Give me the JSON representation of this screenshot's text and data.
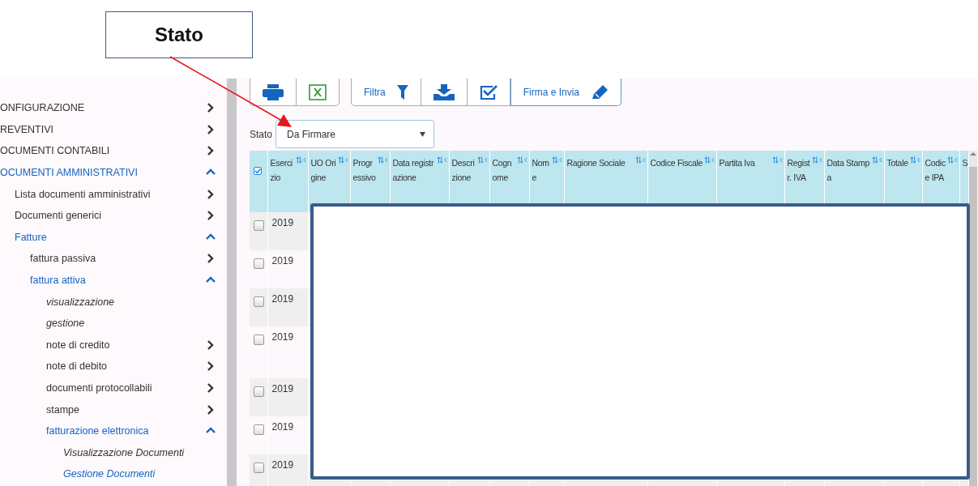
{
  "callout": {
    "label": "Stato"
  },
  "sidebar": {
    "items": [
      {
        "label": "ONFIGURAZIONE",
        "kind": "folder",
        "expanded": false,
        "active": false
      },
      {
        "label": "REVENTIVI",
        "kind": "folder",
        "expanded": false,
        "active": false
      },
      {
        "label": "OCUMENTI CONTABILI",
        "kind": "folder",
        "expanded": false,
        "active": false
      },
      {
        "label": "OCUMENTI AMMINISTRATIVI",
        "kind": "folder",
        "expanded": true,
        "active": true,
        "children": [
          {
            "label": "Lista documenti amministrativi",
            "kind": "folder",
            "expanded": false,
            "active": false
          },
          {
            "label": "Documenti generici",
            "kind": "folder",
            "expanded": false,
            "active": false
          },
          {
            "label": "Fatture",
            "kind": "folder",
            "expanded": true,
            "active": true,
            "children": [
              {
                "label": "fattura passiva",
                "kind": "folder",
                "expanded": false,
                "active": false
              },
              {
                "label": "fattura attiva",
                "kind": "folder",
                "expanded": true,
                "active": true,
                "children": [
                  {
                    "label": "visualizzazione",
                    "kind": "page",
                    "active": false
                  },
                  {
                    "label": "gestione",
                    "kind": "page",
                    "active": false
                  },
                  {
                    "label": "note di credito",
                    "kind": "folder",
                    "expanded": false,
                    "active": false
                  },
                  {
                    "label": "note di debito",
                    "kind": "folder",
                    "expanded": false,
                    "active": false
                  },
                  {
                    "label": "documenti protocollabili",
                    "kind": "folder",
                    "expanded": false,
                    "active": false
                  },
                  {
                    "label": "stampe",
                    "kind": "folder",
                    "expanded": false,
                    "active": false
                  },
                  {
                    "label": "fatturazione elettronica",
                    "kind": "folder",
                    "expanded": true,
                    "active": true,
                    "children": [
                      {
                        "label": "Visualizzazione Documenti",
                        "kind": "page",
                        "active": false
                      },
                      {
                        "label": "Gestione Documenti",
                        "kind": "page",
                        "active": true
                      }
                    ]
                  }
                ]
              }
            ]
          }
        ]
      }
    ]
  },
  "toolbar": [
    {
      "buttons": [
        {
          "kind": "print"
        },
        {
          "kind": "excel"
        }
      ]
    },
    {
      "buttons": [
        {
          "kind": "filter",
          "label": "Filtra",
          "highlighted": false
        },
        {
          "kind": "download",
          "highlighted": false
        },
        {
          "kind": "check",
          "highlighted": false
        },
        {
          "kind": "pencil",
          "label": "Firma e Invia",
          "highlighted": true
        }
      ]
    }
  ],
  "filter": {
    "label": "Stato",
    "value": "Da Firmare"
  },
  "table": {
    "select_all": {
      "checked": true
    },
    "columns": [
      {
        "label": "Esercizio",
        "sortable": true
      },
      {
        "label": "UO Origine",
        "sortable": true
      },
      {
        "label": "Progressivo",
        "sortable": true
      },
      {
        "label": "Data registrazione",
        "sortable": true
      },
      {
        "label": "Descrizione",
        "sortable": true
      },
      {
        "label": "Cognome",
        "sortable": true
      },
      {
        "label": "Nome",
        "sortable": true
      },
      {
        "label": "Ragione Sociale",
        "sortable": true
      },
      {
        "label": "Codice Fiscale",
        "sortable": true
      },
      {
        "label": "Partita Iva",
        "sortable": true
      },
      {
        "label": "Registr. IVA",
        "sortable": true
      },
      {
        "label": "Data Stampa",
        "sortable": true
      },
      {
        "label": "Totale",
        "sortable": true
      },
      {
        "label": "Codice IPA",
        "sortable": true
      },
      {
        "label": "S",
        "sortable": false
      }
    ],
    "rows": [
      {
        "checked": false,
        "esercizio": "2019"
      },
      {
        "checked": false,
        "esercizio": "2019"
      },
      {
        "checked": false,
        "esercizio": "2019"
      },
      {
        "checked": false,
        "esercizio": "2019"
      },
      {
        "checked": false,
        "esercizio": "2019"
      },
      {
        "checked": false,
        "esercizio": "2019"
      },
      {
        "checked": false,
        "esercizio": "2019"
      }
    ],
    "redacted": true
  }
}
